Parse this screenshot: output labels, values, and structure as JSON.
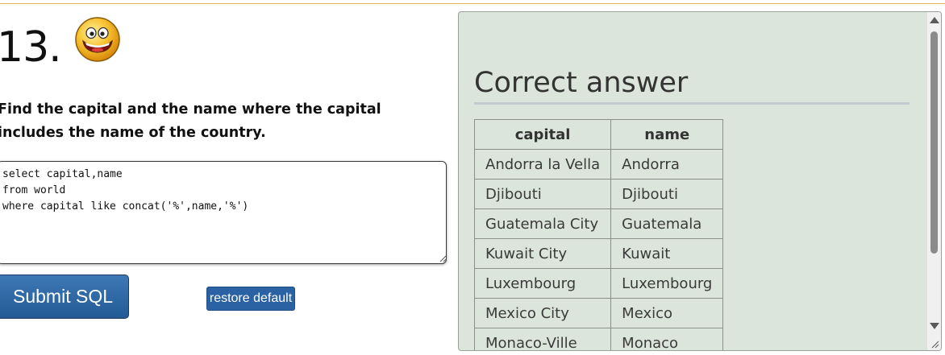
{
  "question": {
    "number": "13.",
    "text": "Find the capital and the name where the capital includes the name of the country."
  },
  "editor": {
    "sql": "select capital,name\nfrom world\nwhere capital like concat('%',name,'%')"
  },
  "buttons": {
    "submit_label": "Submit SQL",
    "restore_label": "restore default"
  },
  "answer": {
    "title": "Correct answer",
    "columns": [
      "capital",
      "name"
    ],
    "rows": [
      [
        "Andorra la Vella",
        "Andorra"
      ],
      [
        "Djibouti",
        "Djibouti"
      ],
      [
        "Guatemala City",
        "Guatemala"
      ],
      [
        "Kuwait City",
        "Kuwait"
      ],
      [
        "Luxembourg",
        "Luxembourg"
      ],
      [
        "Mexico City",
        "Mexico"
      ],
      [
        "Monaco-Ville",
        "Monaco"
      ]
    ]
  },
  "colors": {
    "accent_rule": "#e3b25e",
    "submit_button": "#2d6aa8",
    "answer_panel_bg": "#dce5dc"
  },
  "icons": {
    "mood": "grinning-smiley-icon"
  }
}
